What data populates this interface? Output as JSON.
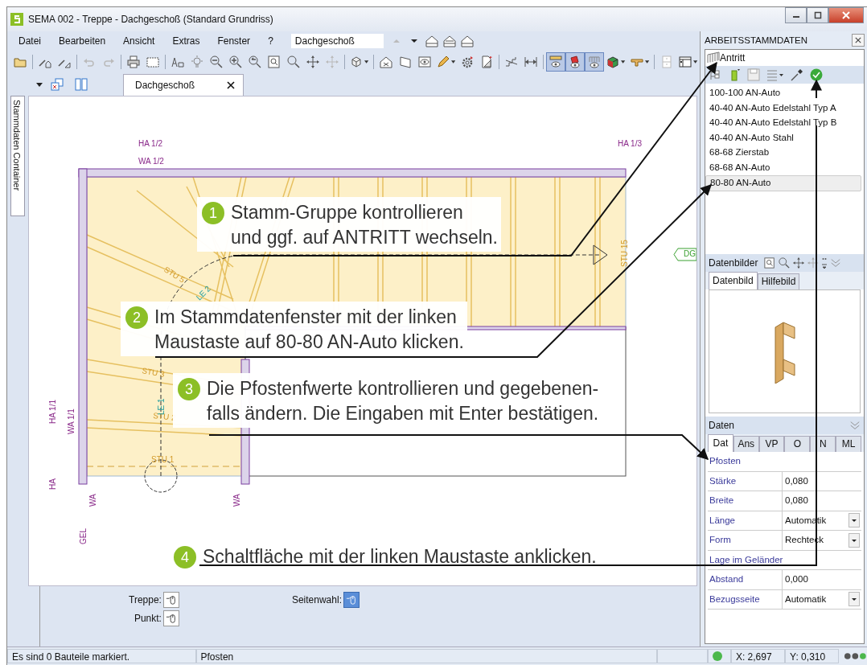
{
  "window": {
    "title": "SEMA  002 - Treppe  - Dachgeschoß (Standard Grundriss)"
  },
  "menu": [
    "Datei",
    "Bearbeiten",
    "Ansicht",
    "Extras",
    "Fenster",
    "?"
  ],
  "floor_selector": {
    "value": "Dachgeschoß"
  },
  "toolbar_buttons": [
    {
      "pressed": false
    },
    {
      "pressed": false
    },
    {
      "pressed": false
    },
    {
      "pressed": false
    },
    {
      "pressed": false
    },
    {
      "pressed": false
    },
    {
      "pressed": false
    },
    {
      "pressed": false
    },
    {
      "pressed": false
    },
    {
      "pressed": false
    },
    {
      "pressed": false
    },
    {
      "pressed": false
    },
    {
      "pressed": false
    },
    {
      "pressed": false
    },
    {
      "pressed": false
    },
    {
      "pressed": false
    },
    {
      "pressed": false
    },
    {
      "pressed": false
    },
    {
      "pressed": false
    },
    {
      "pressed": false
    },
    {
      "pressed": false
    },
    {
      "pressed": false
    },
    {
      "pressed": false
    },
    {
      "pressed": false
    },
    {
      "pressed": false
    },
    {
      "pressed": true
    },
    {
      "pressed": true
    },
    {
      "pressed": true
    },
    {
      "pressed": false
    },
    {
      "pressed": false
    },
    {
      "pressed": false
    },
    {
      "pressed": false
    }
  ],
  "side_tab": "Stammdaten Container",
  "document_tabs": [
    {
      "label": "Dachgeschoß",
      "selected": true
    }
  ],
  "drawing_labels": [
    {
      "text": "HA 1/2",
      "kind": "axis"
    },
    {
      "text": "WA 1/2",
      "kind": "axis"
    },
    {
      "text": "HA 1/3",
      "kind": "axis"
    },
    {
      "text": "HA 1/1",
      "kind": "axis"
    },
    {
      "text": "WA 1/1",
      "kind": "axis"
    },
    {
      "text": "HA",
      "kind": "axis"
    },
    {
      "text": "WA",
      "kind": "axis"
    },
    {
      "text": "WA",
      "kind": "axis"
    },
    {
      "text": "GEL",
      "kind": "axis"
    },
    {
      "text": "STU 5",
      "kind": "step"
    },
    {
      "text": "STU 3",
      "kind": "step"
    },
    {
      "text": "STU 2",
      "kind": "step"
    },
    {
      "text": "STU 1",
      "kind": "step"
    },
    {
      "text": "STU 15",
      "kind": "step"
    },
    {
      "text": "LE 2",
      "kind": "line"
    },
    {
      "text": "LE 1",
      "kind": "line"
    },
    {
      "text": "DG",
      "kind": "tag"
    }
  ],
  "callouts": [
    {
      "number": "1",
      "lines": [
        "Stamm-Gruppe kontrollieren",
        "und ggf. auf  ANTRITT  wechseln."
      ]
    },
    {
      "number": "2",
      "lines": [
        "Im Stammdatenfenster mit der linken",
        "Maustaste auf  80-80 AN-Auto klicken."
      ]
    },
    {
      "number": "3",
      "lines": [
        "Die Pfostenfwerte kontrollieren und gegebenen-",
        "falls ändern. Die Eingaben mit Enter bestätigen."
      ]
    },
    {
      "number": "4",
      "lines": [
        "Schaltfläche mit der linken Maustaste anklicken."
      ]
    }
  ],
  "bottom_options": [
    {
      "label": "Treppe:",
      "selected": false
    },
    {
      "label": "Punkt:",
      "selected": false
    },
    {
      "label": "Seitenwahl:",
      "selected": true
    }
  ],
  "status_bar": {
    "message": "Es sind 0 Bauteile markiert.",
    "object": "Pfosten",
    "x": "X: 2,697",
    "y": "Y: 0,310"
  },
  "panel": {
    "title": "ARBEITSSTAMMDATEN",
    "group": "Antritt",
    "items": [
      {
        "label": "100-100 AN-Auto",
        "selected": false
      },
      {
        "label": "40-40 AN-Auto Edelstahl Typ A",
        "selected": false
      },
      {
        "label": "40-40 AN-Auto Edelstahl Typ B",
        "selected": false
      },
      {
        "label": "40-40 AN-Auto Stahl",
        "selected": false
      },
      {
        "label": "68-68  Zierstab",
        "selected": false
      },
      {
        "label": "68-68 AN-Auto",
        "selected": false
      },
      {
        "label": "80-80 AN-Auto",
        "selected": true
      }
    ],
    "images": {
      "title": "Datenbilder",
      "tabs": [
        {
          "label": "Datenbild",
          "selected": true
        },
        {
          "label": "Hilfebild",
          "selected": false
        }
      ]
    },
    "data": {
      "title": "Daten",
      "tabs": [
        {
          "label": "Dat",
          "selected": true
        },
        {
          "label": "Ans",
          "selected": false
        },
        {
          "label": "VP",
          "selected": false
        },
        {
          "label": "O",
          "selected": false
        },
        {
          "label": "N",
          "selected": false
        },
        {
          "label": "ML",
          "selected": false
        }
      ],
      "rows": [
        {
          "kind": "section",
          "label": "Pfosten"
        },
        {
          "kind": "value",
          "label": "Stärke",
          "value": "0,080"
        },
        {
          "kind": "value",
          "label": "Breite",
          "value": "0,080"
        },
        {
          "kind": "dropdown",
          "label": "Länge",
          "value": "Automatik"
        },
        {
          "kind": "dropdown",
          "label": "Form",
          "value": "Rechteck"
        },
        {
          "kind": "section",
          "label": "Lage im Geländer"
        },
        {
          "kind": "value",
          "label": "Abstand",
          "value": "0,000"
        },
        {
          "kind": "dropdown",
          "label": "Bezugsseite",
          "value": "Automatik"
        }
      ]
    }
  }
}
